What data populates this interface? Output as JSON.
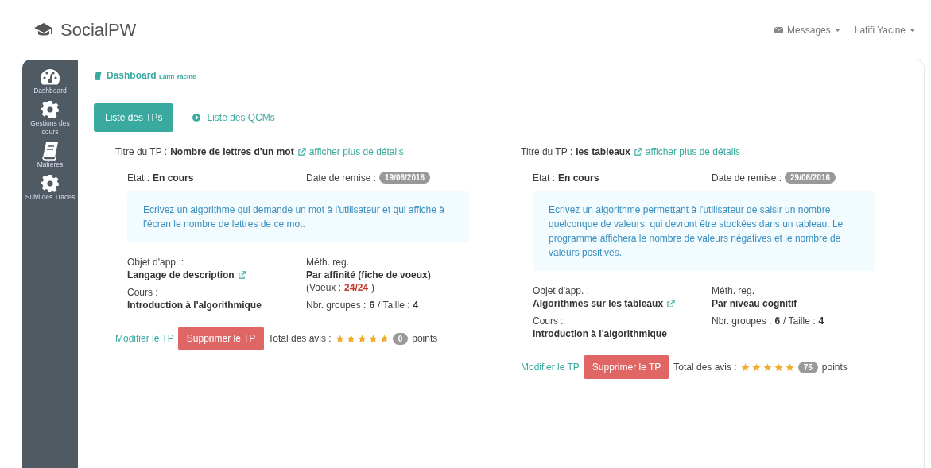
{
  "navbar": {
    "brand": "SocialPW",
    "messages": "Messages",
    "user": "Lafifi Yacine"
  },
  "sidebar": {
    "items": [
      {
        "label": "Dashboard",
        "kind": "gauge"
      },
      {
        "label": "Gestions des cours",
        "kind": "gear"
      },
      {
        "label": "Matieres",
        "kind": "book"
      },
      {
        "label": "Suivi des Traces",
        "kind": "gear"
      }
    ]
  },
  "breadcrumb": {
    "title": "Dashboard",
    "user": "Lafifi Yacine"
  },
  "tabs": [
    {
      "label": "Liste des TPs",
      "selected": true
    },
    {
      "label": "Liste des QCMs",
      "selected": false
    }
  ],
  "tps": [
    {
      "title_label": "Titre du TP :",
      "title": "Nombre de lettres d'un mot",
      "details": "afficher plus de détails",
      "etat_label": "Etat :",
      "etat": "En cours",
      "date_label": "Date de remise :",
      "date": "19/06/2016",
      "description": "Ecrivez un algorithme qui demande un mot à l'utilisateur et qui affiche à l'écran le nombre de lettres de ce mot.",
      "objet_label": "Objet d'app. :",
      "objet": "Langage de description",
      "cours_label": "Cours :",
      "cours": "Introduction à l'algorithmique",
      "meth_label": "Méth. reg.",
      "meth": "Par affinité (fiche de voeux)",
      "voeux_label": "(Voeux :",
      "voeux": "24/24",
      "voeux_end": ")",
      "groupes_label": "Nbr. groupes :",
      "groupes": "6",
      "taille_label": "/ Taille :",
      "taille": "4",
      "modify": "Modifier le TP",
      "delete": "Supprimer le TP",
      "avis_label": "Total des avis :",
      "stars": 5,
      "points": "0",
      "points_label": "points"
    },
    {
      "title_label": "Titre du TP :",
      "title": "les tableaux",
      "details": "afficher plus de détails",
      "etat_label": "Etat :",
      "etat": "En cours",
      "date_label": "Date de remise :",
      "date": "29/06/2016",
      "description": "Ecrivez un algorithme permettant à l'utilisateur de saisir un nombre quelconque de valeurs, qui devront être stockées dans un tableau. Le programme affichera le nombre de valeurs négatives et le nombre de valeurs positives.",
      "objet_label": "Objet d'app. :",
      "objet": "Algorithmes sur les tableaux",
      "cours_label": "Cours :",
      "cours": "Introduction à l'algorithmique",
      "meth_label": "Méth. reg.",
      "meth": "Par niveau cognitif",
      "groupes_label": "Nbr. groupes :",
      "groupes": "6",
      "taille_label": "/ Taille :",
      "taille": "4",
      "modify": "Modifier le TP",
      "delete": "Supprimer le TP",
      "avis_label": "Total des avis :",
      "stars": 5,
      "points": "75",
      "points_label": "points"
    }
  ]
}
